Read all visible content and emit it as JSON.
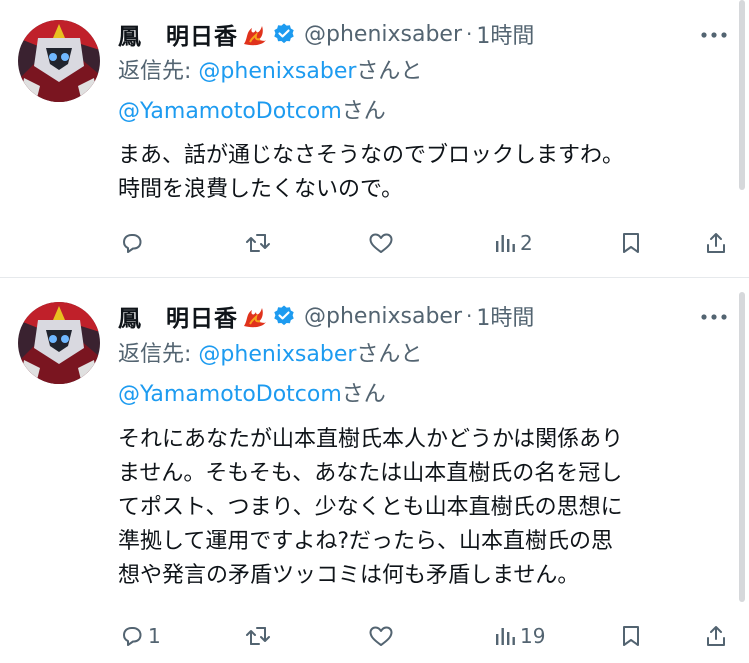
{
  "tweets": [
    {
      "display_name": "鳳　明日香",
      "handle": "@phenixsaber",
      "separator": "·",
      "time": "1時間",
      "reply_prefix": "返信先: ",
      "reply_user1": "@phenixsaber",
      "reply_mid": "さんと",
      "reply_user2": "@YamamotoDotcom",
      "reply_suffix": "さん",
      "body_lines": [
        "まあ、話が通じなさそうなのでブロックしますわ。",
        "時間を浪費したくないので。"
      ],
      "reply_count": "",
      "retweet_count": "",
      "like_count": "",
      "view_count": "2"
    },
    {
      "display_name": "鳳　明日香",
      "handle": "@phenixsaber",
      "separator": "·",
      "time": "1時間",
      "reply_prefix": "返信先: ",
      "reply_user1": "@phenixsaber",
      "reply_mid": "さんと",
      "reply_user2": "@YamamotoDotcom",
      "reply_suffix": "さん",
      "body_lines": [
        "それにあなたが山本直樹氏本人かどうかは関係あり",
        "ません。そもそも、あなたは山本直樹氏の名を冠し",
        "てポスト、つまり、少なくとも山本直樹氏の思想に",
        "準拠して運用ですよね?だったら、山本直樹氏の思",
        "想や発言の矛盾ツッコミは何も矛盾しません。"
      ],
      "reply_count": "1",
      "retweet_count": "",
      "like_count": "",
      "view_count": "19"
    }
  ],
  "icons": {
    "verified": "verified-badge-icon",
    "more": "more-options-icon",
    "reply": "reply-icon",
    "retweet": "retweet-icon",
    "like": "like-icon",
    "views": "views-icon",
    "bookmark": "bookmark-icon",
    "share": "share-icon"
  },
  "colors": {
    "link": "#1d9bf0",
    "muted": "#536471",
    "text": "#0f1419",
    "verified": "#1d9bf0"
  }
}
